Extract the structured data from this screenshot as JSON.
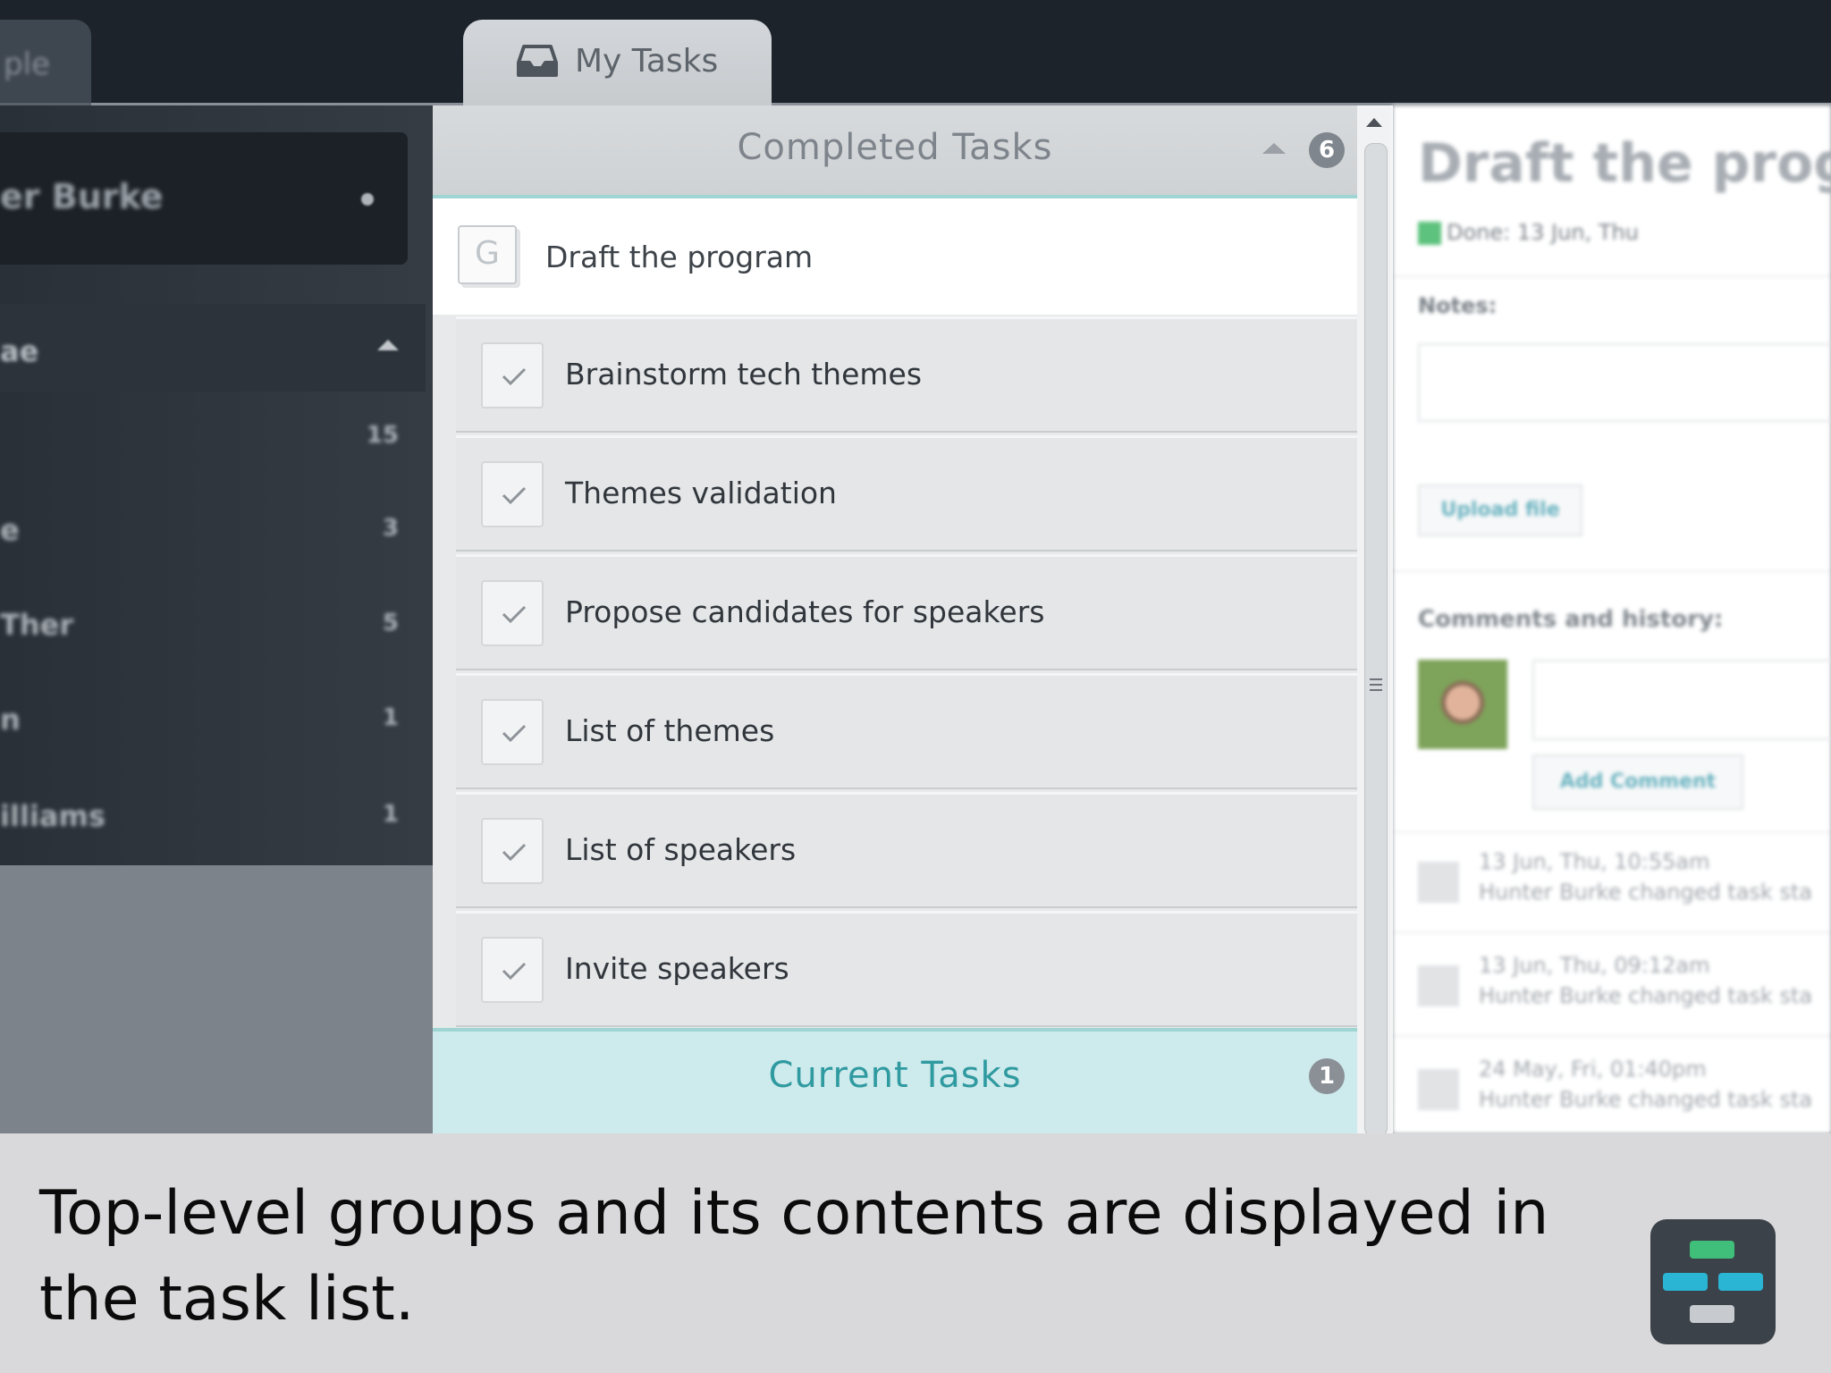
{
  "tabs": {
    "left_partial": "ple",
    "my_tasks": "My Tasks"
  },
  "sidebar": {
    "user_name": "er Burke",
    "header_label": "ae",
    "items": [
      {
        "label": "",
        "count": "15"
      },
      {
        "label": "e",
        "count": "3"
      },
      {
        "label": "Ther",
        "count": "5"
      },
      {
        "label": "n",
        "count": "1"
      },
      {
        "label": "illiams",
        "count": "1"
      }
    ]
  },
  "completed": {
    "title": "Completed Tasks",
    "count": "6",
    "parent_icon": "G",
    "parent_task": "Draft the program",
    "tasks": [
      "Brainstorm tech themes",
      "Themes validation",
      "Propose candidates for speakers",
      "List of themes",
      "List of speakers",
      "Invite speakers"
    ]
  },
  "current": {
    "title": "Current Tasks",
    "count": "1"
  },
  "detail": {
    "title": "Draft the progra",
    "done_text": "Done: 13 Jun, Thu",
    "notes_label": "Notes:",
    "upload_button": "Upload file",
    "comments_label": "Comments and history:",
    "add_comment_button": "Add Comment",
    "history": [
      {
        "time": "13 Jun, Thu, 10:55am",
        "text": "Hunter Burke changed task sta"
      },
      {
        "time": "13 Jun, Thu, 09:12am",
        "text": "Hunter Burke changed task sta"
      },
      {
        "time": "24 May, Fri, 01:40pm",
        "text": "Hunter Burke changed task sta"
      }
    ]
  },
  "caption": "Top-level groups and its contents are displayed in the task list.",
  "colors": {
    "accent_teal": "#2f9aa0",
    "done_green": "#5dc27d",
    "logo_bg": "#3b4249"
  }
}
